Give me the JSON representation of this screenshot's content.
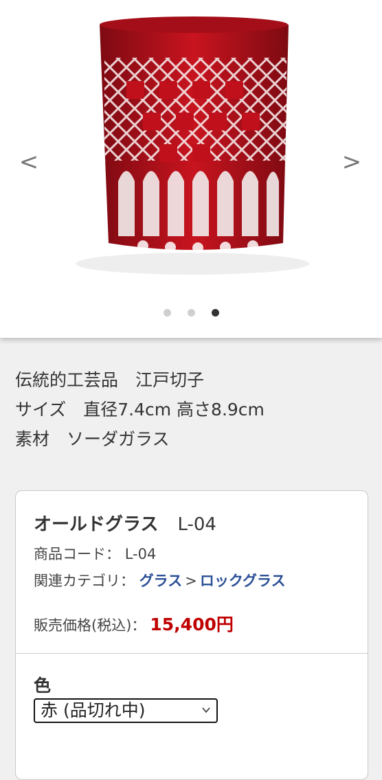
{
  "gallery": {
    "prev_arrow": "<",
    "next_arrow": ">",
    "slide_count": 3,
    "active_slide": 3,
    "image_main_color": "#b0101a"
  },
  "description": {
    "line1": "伝統的工芸品　江戸切子",
    "line2": "サイズ　直径7.4cm 高さ8.9cm",
    "line3": "素材　ソーダガラス"
  },
  "product": {
    "name": "オールドグラス",
    "code_suffix": "L-04",
    "code_label": "商品コード：",
    "code_value": "L-04",
    "category_label": "関連カテゴリ：",
    "category_1": "グラス",
    "category_sep": ">",
    "category_2": "ロックグラス",
    "price_label": "販売価格(税込)：",
    "price_value": "15,400円",
    "price_color": "#c00000",
    "link_color": "#2a4f95"
  },
  "options": {
    "color_label": "色",
    "color_selected": "赤 (品切れ中)"
  }
}
